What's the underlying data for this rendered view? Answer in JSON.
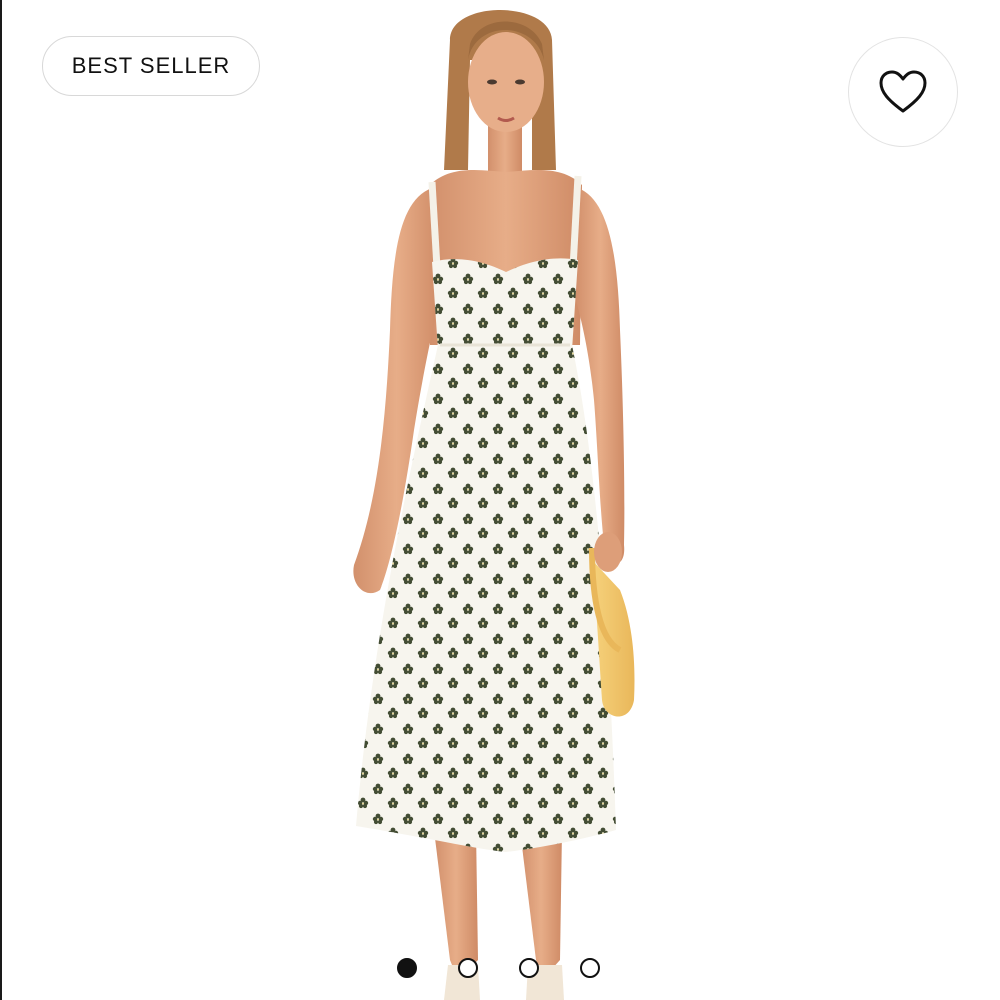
{
  "badge": {
    "label": "BEST SELLER"
  },
  "favorite": {
    "icon": "heart-icon"
  },
  "gallery": {
    "image_count": 4,
    "active_index": 0,
    "dots": [
      {
        "active": true
      },
      {
        "active": false
      },
      {
        "active": false
      },
      {
        "active": false
      }
    ]
  },
  "colors": {
    "badge_border": "#d8d8d8",
    "text": "#111111",
    "dress": "#f7f5ee",
    "dress_print": "#2f3a1f",
    "bag": "#f2c46a",
    "skin": "#dfa07c",
    "hair": "#b07a4a"
  }
}
